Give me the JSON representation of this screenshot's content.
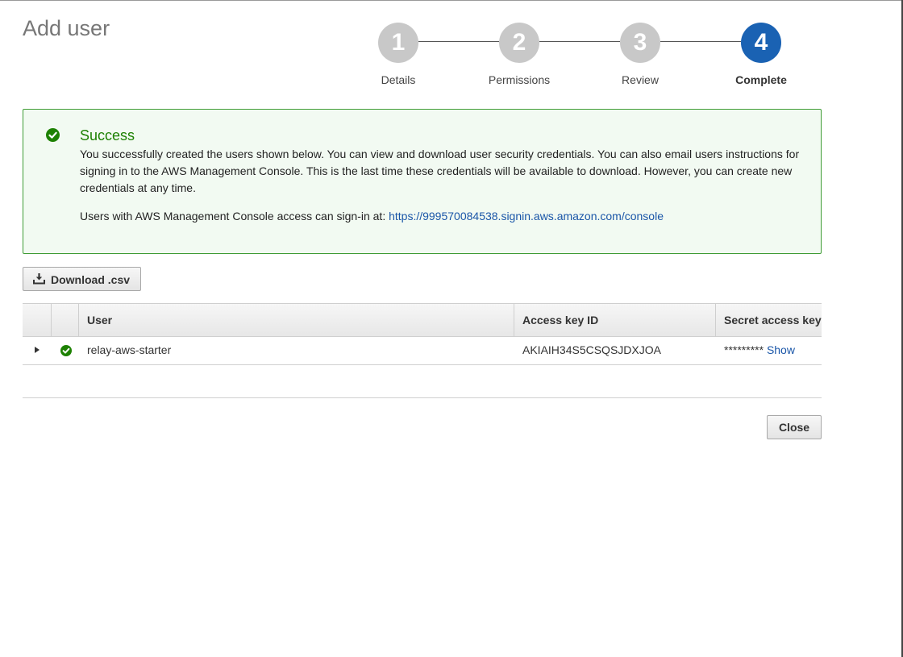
{
  "page": {
    "title": "Add user"
  },
  "stepper": {
    "steps": [
      {
        "number": "1",
        "label": "Details"
      },
      {
        "number": "2",
        "label": "Permissions"
      },
      {
        "number": "3",
        "label": "Review"
      },
      {
        "number": "4",
        "label": "Complete"
      }
    ],
    "active_step": "4"
  },
  "alert": {
    "title": "Success",
    "body": "You successfully created the users shown below. You can view and download user security credentials. You can also email users instructions for signing in to the AWS Management Console. This is the last time these credentials will be available to download. However, you can create new credentials at any time.",
    "signin_prefix": "Users with AWS Management Console access can sign-in at:",
    "signin_url": "https://999570084538.signin.aws.amazon.com/console",
    "icon": "check-circle-icon"
  },
  "toolbar": {
    "download_label": "Download .csv",
    "download_icon": "download-icon"
  },
  "table": {
    "columns": [
      "User",
      "Access key ID",
      "Secret access key"
    ],
    "rows": [
      {
        "user": "relay-aws-starter",
        "access_key_id": "AKIAIH34S5CSQSJDXJOA",
        "secret_masked": "*********",
        "show_label": "Show"
      }
    ]
  },
  "footer": {
    "close_label": "Close"
  },
  "colors": {
    "success": "#1d8102",
    "active_step": "#1a62b3",
    "inactive_step": "#c8c8c8",
    "link": "#1a56a8"
  }
}
